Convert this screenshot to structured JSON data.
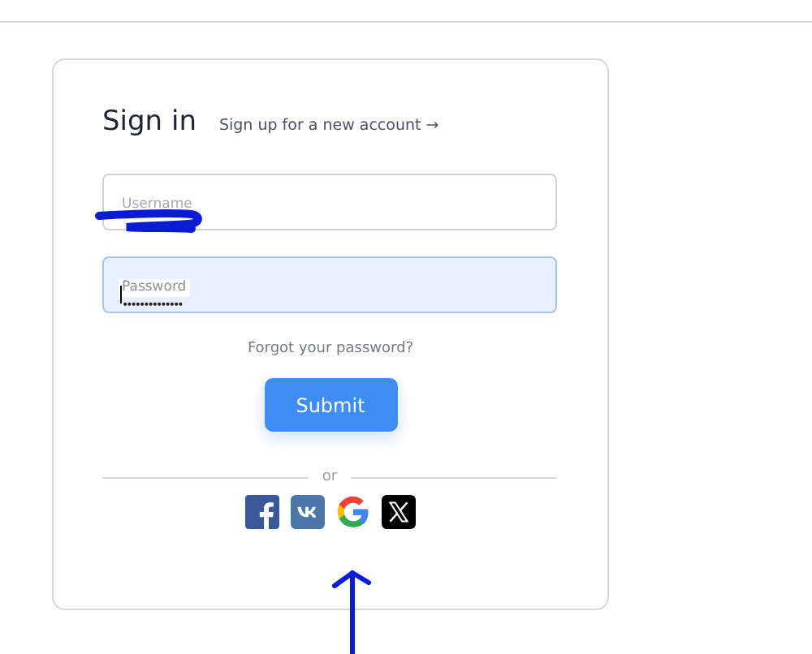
{
  "sign_in": {
    "title": "Sign in",
    "signup_link": "Sign up for a new account →"
  },
  "fields": [
    {
      "kind": "text",
      "label": "Username",
      "value_redacted": true,
      "focused": false
    },
    {
      "kind": "password",
      "label": "Password",
      "value": "••••••••••••••",
      "focused": true
    }
  ],
  "forgot_link": "Forgot your password?",
  "submit": "Submit",
  "separator": "or",
  "social": [
    {
      "kind": "facebook"
    },
    {
      "kind": "vk"
    },
    {
      "kind": "google",
      "arrow_marked": true
    },
    {
      "kind": "x"
    }
  ]
}
